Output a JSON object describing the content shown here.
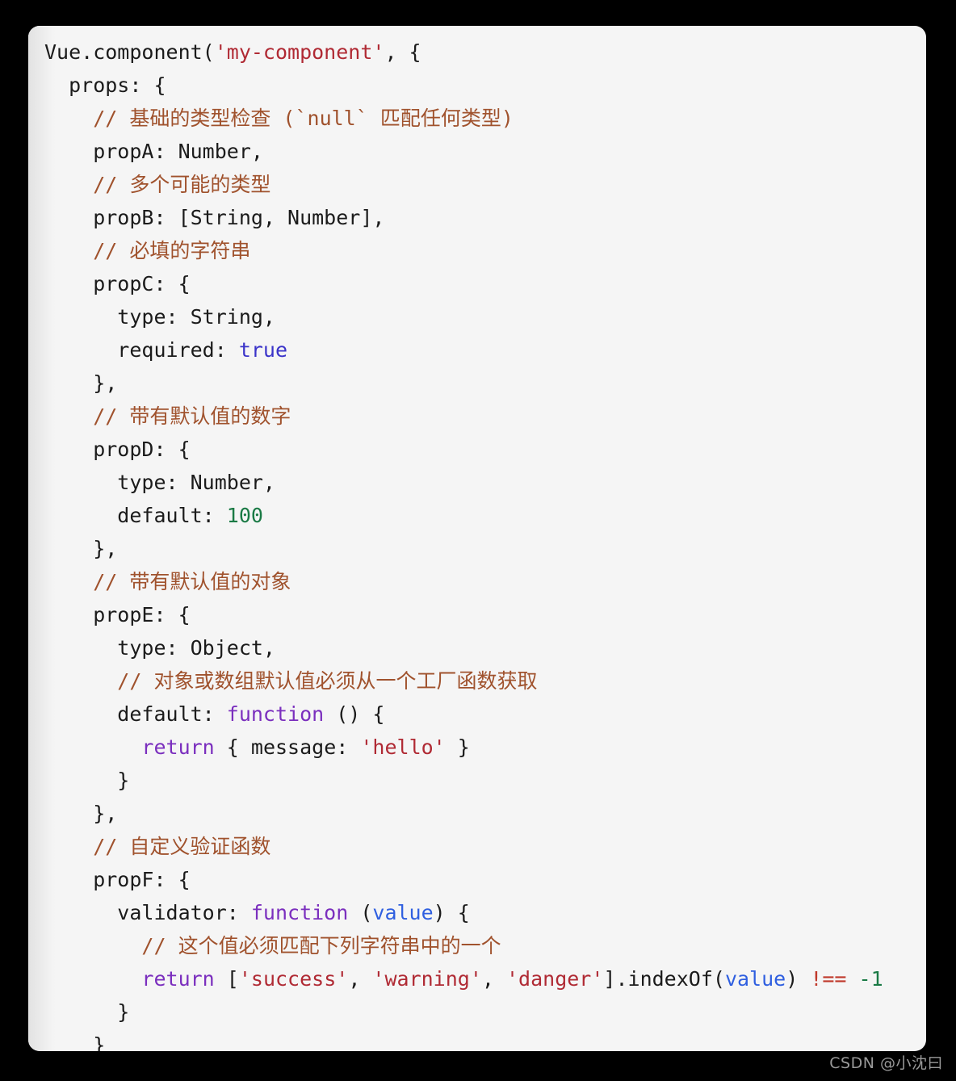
{
  "page": {
    "background_color": "#000000",
    "watermark": "CSDN @小沈曰"
  },
  "code_card": {
    "background_color": "#f5f5f5",
    "language": "javascript",
    "colors": {
      "plain": "#1b1b1b",
      "comment": "#a0522d",
      "string": "#b02a34",
      "keyword": "#7b2fbe",
      "boolean": "#3b34c9",
      "number": "#1a7a45",
      "parameter": "#2f5fe0",
      "operator": "#c0392b"
    },
    "lines": [
      {
        "n": 1,
        "text": "Vue.component('my-component', {"
      },
      {
        "n": 2,
        "text": "  props: {"
      },
      {
        "n": 3,
        "text": "    // 基础的类型检查 (`null` 匹配任何类型)"
      },
      {
        "n": 4,
        "text": "    propA: Number,"
      },
      {
        "n": 5,
        "text": "    // 多个可能的类型"
      },
      {
        "n": 6,
        "text": "    propB: [String, Number],"
      },
      {
        "n": 7,
        "text": "    // 必填的字符串"
      },
      {
        "n": 8,
        "text": "    propC: {"
      },
      {
        "n": 9,
        "text": "      type: String,"
      },
      {
        "n": 10,
        "text": "      required: true"
      },
      {
        "n": 11,
        "text": "    },"
      },
      {
        "n": 12,
        "text": "    // 带有默认值的数字"
      },
      {
        "n": 13,
        "text": "    propD: {"
      },
      {
        "n": 14,
        "text": "      type: Number,"
      },
      {
        "n": 15,
        "text": "      default: 100"
      },
      {
        "n": 16,
        "text": "    },"
      },
      {
        "n": 17,
        "text": "    // 带有默认值的对象"
      },
      {
        "n": 18,
        "text": "    propE: {"
      },
      {
        "n": 19,
        "text": "      type: Object,"
      },
      {
        "n": 20,
        "text": "      // 对象或数组默认值必须从一个工厂函数获取"
      },
      {
        "n": 21,
        "text": "      default: function () {"
      },
      {
        "n": 22,
        "text": "        return { message: 'hello' }"
      },
      {
        "n": 23,
        "text": "      }"
      },
      {
        "n": 24,
        "text": "    },"
      },
      {
        "n": 25,
        "text": "    // 自定义验证函数"
      },
      {
        "n": 26,
        "text": "    propF: {"
      },
      {
        "n": 27,
        "text": "      validator: function (value) {"
      },
      {
        "n": 28,
        "text": "        // 这个值必须匹配下列字符串中的一个"
      },
      {
        "n": 29,
        "text": "        return ['success', 'warning', 'danger'].indexOf(value) !== -1"
      },
      {
        "n": 30,
        "text": "      }"
      },
      {
        "n": 31,
        "text": "    }"
      }
    ],
    "tokens": [
      [
        {
          "t": "Vue.component(",
          "c": "plain"
        },
        {
          "t": "'my-component'",
          "c": "string"
        },
        {
          "t": ", {",
          "c": "plain"
        }
      ],
      [
        {
          "t": "  props: {",
          "c": "plain"
        }
      ],
      [
        {
          "t": "    // 基础的类型检查 (`null` 匹配任何类型)",
          "c": "comment"
        }
      ],
      [
        {
          "t": "    propA: Number,",
          "c": "plain"
        }
      ],
      [
        {
          "t": "    // 多个可能的类型",
          "c": "comment"
        }
      ],
      [
        {
          "t": "    propB: [String, Number],",
          "c": "plain"
        }
      ],
      [
        {
          "t": "    // 必填的字符串",
          "c": "comment"
        }
      ],
      [
        {
          "t": "    propC: {",
          "c": "plain"
        }
      ],
      [
        {
          "t": "      type: String,",
          "c": "plain"
        }
      ],
      [
        {
          "t": "      required: ",
          "c": "plain"
        },
        {
          "t": "true",
          "c": "boolean"
        }
      ],
      [
        {
          "t": "    },",
          "c": "plain"
        }
      ],
      [
        {
          "t": "    // 带有默认值的数字",
          "c": "comment"
        }
      ],
      [
        {
          "t": "    propD: {",
          "c": "plain"
        }
      ],
      [
        {
          "t": "      type: Number,",
          "c": "plain"
        }
      ],
      [
        {
          "t": "      default: ",
          "c": "plain"
        },
        {
          "t": "100",
          "c": "number"
        }
      ],
      [
        {
          "t": "    },",
          "c": "plain"
        }
      ],
      [
        {
          "t": "    // 带有默认值的对象",
          "c": "comment"
        }
      ],
      [
        {
          "t": "    propE: {",
          "c": "plain"
        }
      ],
      [
        {
          "t": "      type: Object,",
          "c": "plain"
        }
      ],
      [
        {
          "t": "      // 对象或数组默认值必须从一个工厂函数获取",
          "c": "comment"
        }
      ],
      [
        {
          "t": "      default: ",
          "c": "plain"
        },
        {
          "t": "function",
          "c": "keyword"
        },
        {
          "t": " () {",
          "c": "plain"
        }
      ],
      [
        {
          "t": "        ",
          "c": "plain"
        },
        {
          "t": "return",
          "c": "keyword"
        },
        {
          "t": " { message: ",
          "c": "plain"
        },
        {
          "t": "'hello'",
          "c": "string"
        },
        {
          "t": " }",
          "c": "plain"
        }
      ],
      [
        {
          "t": "      }",
          "c": "plain"
        }
      ],
      [
        {
          "t": "    },",
          "c": "plain"
        }
      ],
      [
        {
          "t": "    // 自定义验证函数",
          "c": "comment"
        }
      ],
      [
        {
          "t": "    propF: {",
          "c": "plain"
        }
      ],
      [
        {
          "t": "      validator: ",
          "c": "plain"
        },
        {
          "t": "function",
          "c": "keyword"
        },
        {
          "t": " (",
          "c": "plain"
        },
        {
          "t": "value",
          "c": "parameter"
        },
        {
          "t": ") {",
          "c": "plain"
        }
      ],
      [
        {
          "t": "        // 这个值必须匹配下列字符串中的一个",
          "c": "comment"
        }
      ],
      [
        {
          "t": "        ",
          "c": "plain"
        },
        {
          "t": "return",
          "c": "keyword"
        },
        {
          "t": " [",
          "c": "plain"
        },
        {
          "t": "'success'",
          "c": "string"
        },
        {
          "t": ", ",
          "c": "plain"
        },
        {
          "t": "'warning'",
          "c": "string"
        },
        {
          "t": ", ",
          "c": "plain"
        },
        {
          "t": "'danger'",
          "c": "string"
        },
        {
          "t": "].indexOf(",
          "c": "plain"
        },
        {
          "t": "value",
          "c": "parameter"
        },
        {
          "t": ") ",
          "c": "plain"
        },
        {
          "t": "!==",
          "c": "operator"
        },
        {
          "t": " ",
          "c": "plain"
        },
        {
          "t": "-1",
          "c": "number"
        }
      ],
      [
        {
          "t": "      }",
          "c": "plain"
        }
      ],
      [
        {
          "t": "    }",
          "c": "plain"
        }
      ]
    ]
  }
}
